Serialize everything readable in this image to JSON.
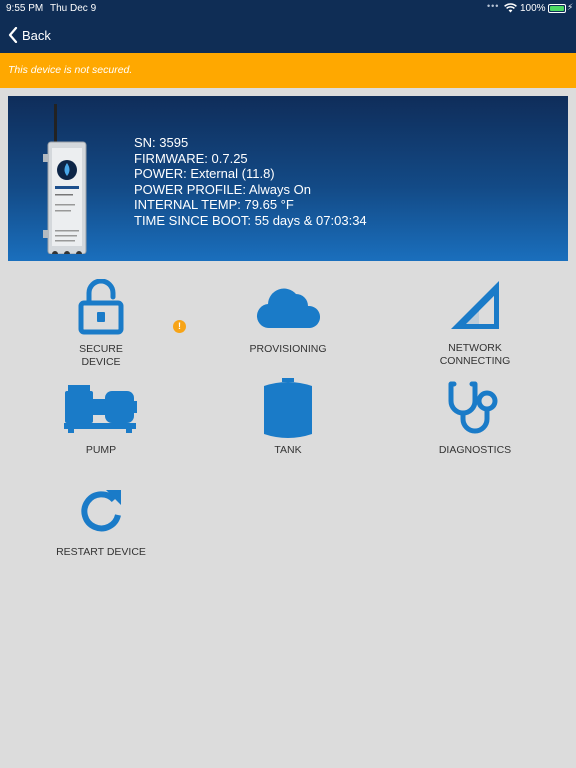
{
  "status_bar": {
    "time": "9:55 PM",
    "date": "Thu Dec 9",
    "battery_percent": "100%",
    "battery_level": 1.0
  },
  "nav": {
    "back_label": "Back"
  },
  "warning": {
    "text": "This device is not secured."
  },
  "device": {
    "sn": "SN: 3595",
    "firmware": "FIRMWARE: 0.7.25",
    "power": "POWER: External (11.8)",
    "power_profile": "POWER PROFILE: Always On",
    "internal_temp": "INTERNAL TEMP: 79.65 °F",
    "time_since_boot": "TIME SINCE BOOT: 55 days & 07:03:34"
  },
  "tiles": {
    "secure_line1": "SECURE",
    "secure_line2": "DEVICE",
    "secure_badge": "!",
    "provisioning": "PROVISIONING",
    "network_line1": "NETWORK",
    "network_line2": "CONNECTING",
    "pump": "PUMP",
    "tank": "TANK",
    "diagnostics": "DIAGNOSTICS",
    "restart": "RESTART DEVICE"
  },
  "colors": {
    "nav_bg": "#0f2d55",
    "warning_bg": "#ffa800",
    "icon_blue": "#1a7bc8",
    "badge": "#f7a417",
    "page_bg": "#dcdcdc"
  },
  "icons": {
    "back": "chevron-left-icon",
    "secure": "unlocked-padlock-icon",
    "provisioning": "cloud-icon",
    "network": "signal-strength-icon",
    "pump": "pump-icon",
    "tank": "tank-icon",
    "diagnostics": "stethoscope-icon",
    "restart": "restart-arrow-icon"
  }
}
